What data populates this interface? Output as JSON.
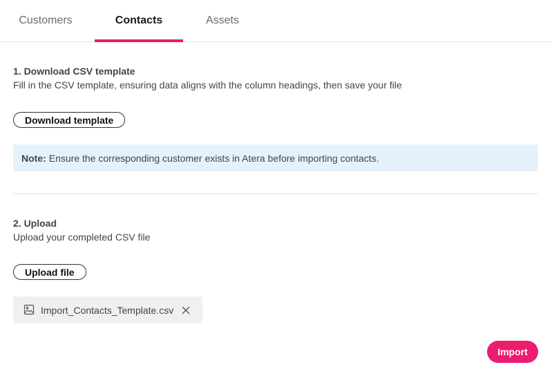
{
  "tabs": [
    {
      "label": "Customers",
      "active": false
    },
    {
      "label": "Contacts",
      "active": true
    },
    {
      "label": "Assets",
      "active": false
    }
  ],
  "step1": {
    "title": "1. Download CSV template",
    "description": "Fill in the CSV template, ensuring data aligns with the column headings, then save your file",
    "button_label": "Download template"
  },
  "note": {
    "label": "Note:",
    "text": "Ensure the corresponding customer exists in Atera before importing contacts."
  },
  "step2": {
    "title": "2. Upload",
    "description": "Upload your completed CSV file",
    "button_label": "Upload file"
  },
  "file": {
    "name": "Import_Contacts_Template.csv",
    "icon": "image-icon"
  },
  "footer": {
    "import_label": "Import"
  },
  "colors": {
    "accent": "#ec1c6e",
    "note_bg": "#e5f2fc",
    "chip_bg": "#f0f0f0"
  }
}
